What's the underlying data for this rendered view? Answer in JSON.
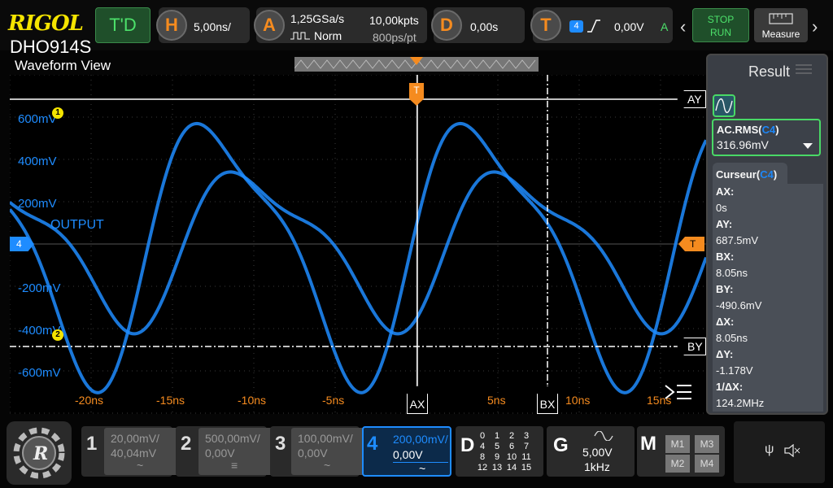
{
  "brand": {
    "logo": "RIGOL",
    "model": "DHO914S"
  },
  "topbar": {
    "trigger_mode_label": "T'D",
    "horizontal": {
      "key": "H",
      "timebase": "5,00ns/"
    },
    "acquire": {
      "key": "A",
      "sample_rate": "1,25GSa/s",
      "memory": "10,00kpts",
      "mode": "Norm",
      "interval": "800ps/pt"
    },
    "delay": {
      "key": "D",
      "value": "0,00s"
    },
    "trigger": {
      "key": "T",
      "source": "4",
      "level": "0,00V",
      "status": "A"
    },
    "stop_label": "STOP",
    "run_label": "RUN",
    "measure_label": "Measure"
  },
  "waveform_view": {
    "title": "Waveform View",
    "y_labels": [
      "600mV",
      "400mV",
      "200mV",
      "-200mV",
      "-400mV",
      "-600mV"
    ],
    "x_labels": [
      "-20ns",
      "-15ns",
      "-10ns",
      "-5ns",
      "5ns",
      "10ns",
      "15ns"
    ],
    "label_output": "OUTPUT",
    "marker_1": "1",
    "marker_2": "2",
    "marker_4": "4",
    "marker_t": "T",
    "trigger_top": "T",
    "cursor_ay": "AY",
    "cursor_by": "BY",
    "cursor_ax": "AX",
    "cursor_bx": "BX"
  },
  "result": {
    "title": "Result",
    "ac_label": "AC.RMS(",
    "ac_ch": "C4",
    "ac_close": ")",
    "ac_value": "316.96mV",
    "cursor_label": "Curseur(",
    "cursor_ch": "C4",
    "cursor_close": ")",
    "rows": [
      {
        "label": "AX:",
        "value": "0s"
      },
      {
        "label": "AY:",
        "value": "687.5mV"
      },
      {
        "label": "BX:",
        "value": "8.05ns"
      },
      {
        "label": "BY:",
        "value": "-490.6mV"
      },
      {
        "label": "ΔX:",
        "value": "8.05ns"
      },
      {
        "label": "ΔY:",
        "value": "-1.178V"
      },
      {
        "label": "1/ΔX:",
        "value": "124.2MHz"
      }
    ]
  },
  "channels": [
    {
      "num": "1",
      "scale": "20,00mV/",
      "offset": "40,04mV",
      "coupling": "~"
    },
    {
      "num": "2",
      "scale": "500,00mV/",
      "offset": "0,00V",
      "coupling": "≡"
    },
    {
      "num": "3",
      "scale": "100,00mV/",
      "offset": "0,00V",
      "coupling": "~"
    },
    {
      "num": "4",
      "scale": "200,00mV/",
      "offset": "0,00V",
      "coupling": "~"
    }
  ],
  "digital": {
    "key": "D",
    "grid": [
      "0",
      "1",
      "2",
      "3",
      "4",
      "5",
      "6",
      "7",
      "8",
      "9",
      "10",
      "11",
      "12",
      "13",
      "14",
      "15"
    ]
  },
  "generator": {
    "key": "G",
    "amplitude": "5,00V",
    "frequency": "1kHz"
  },
  "math": {
    "key": "M",
    "items": [
      "M1",
      "M3",
      "M2",
      "M4"
    ]
  },
  "colors": {
    "ch4": "#1e8cff",
    "trigger": "#f58b1f",
    "active": "#4ce06a"
  }
}
